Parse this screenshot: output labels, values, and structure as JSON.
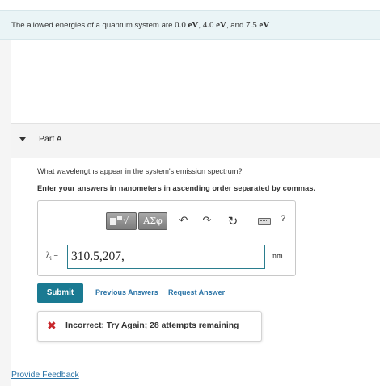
{
  "problem": {
    "prefix": "The allowed energies of a quantum system are ",
    "energies": [
      {
        "value": "0.0",
        "unit": "eV",
        "sep": ", "
      },
      {
        "value": "4.0",
        "unit": "eV",
        "sep": ", and "
      },
      {
        "value": "7.5",
        "unit": "eV",
        "sep": "."
      }
    ]
  },
  "part": {
    "title": "Part A",
    "question": "What wavelengths appear in the system's emission spectrum?",
    "instruction": "Enter your answers in nanometers in ascending order separated by commas."
  },
  "toolbar": {
    "greek_label": "ΑΣφ",
    "undo_glyph": "↶",
    "redo_glyph": "↷",
    "reset_glyph": "↻",
    "help_label": "?"
  },
  "answer": {
    "variable": "λ",
    "subscript": "i",
    "equals": " =",
    "value": "310.5,207,",
    "unit": "nm"
  },
  "actions": {
    "submit_label": "Submit",
    "previous_answers_label": "Previous Answers",
    "request_answer_label": "Request Answer"
  },
  "feedback": {
    "icon_glyph": "✖",
    "message": "Incorrect; Try Again; 28 attempts remaining"
  },
  "footer": {
    "provide_feedback_label": "Provide Feedback"
  },
  "colors": {
    "accent": "#1a7a92",
    "link": "#2a73a6",
    "error": "#c8262b",
    "banner": "#eaf4f6"
  }
}
